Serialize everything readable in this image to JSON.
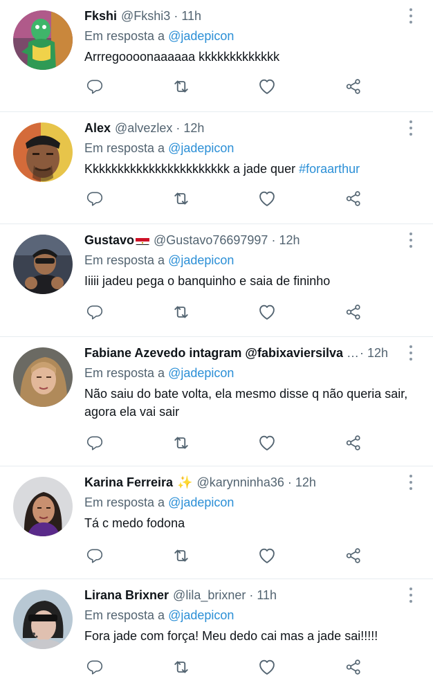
{
  "reply_prefix": "Em resposta a",
  "tweets": [
    {
      "name": "Fkshi",
      "handle": "@Fkshi3",
      "separator": "·",
      "time": "11h",
      "mention": "@jadepicon",
      "text": "Arrregoooonaaaaaa kkkkkkkkkkkkk",
      "avatar": "avatar-fkshi"
    },
    {
      "name": "Alex",
      "handle": "@alvezlex",
      "separator": "·",
      "time": "12h",
      "mention": "@jadepicon",
      "text_before": "Kkkkkkkkkkkkkkkkkkkkkkk a jade quer ",
      "hashtag": "#foraarthur",
      "avatar": "avatar-alex"
    },
    {
      "name": "Gustavo",
      "name_emoji": "flag-egypt",
      "handle": "@Gustavo76697997",
      "separator": "·",
      "time": "12h",
      "mention": "@jadepicon",
      "text": "Iiiii jadeu pega o banquinho e saia de fininho",
      "avatar": "avatar-gustavo"
    },
    {
      "name": "Fabiane Azevedo intagram @fabixaviersilva",
      "truncated_suffix": "…",
      "separator": "·",
      "time": "12h",
      "mention": "@jadepicon",
      "text": "Não saiu do bate volta, ela mesmo disse q não queria sair, agora ela vai sair",
      "avatar": "avatar-fabiane"
    },
    {
      "name": "Karina Ferreira",
      "name_emoji": "✨",
      "handle": "@karynninha36",
      "separator": "·",
      "time": "12h",
      "mention": "@jadepicon",
      "text": "Tá c medo fodona",
      "avatar": "avatar-karina"
    },
    {
      "name": "Lirana Brixner",
      "handle": "@lila_brixner",
      "separator": "·",
      "time": "11h",
      "mention": "@jadepicon",
      "text": "Fora jade com força! Meu dedo cai mas a jade sai!!!!!",
      "avatar": "avatar-lirana"
    }
  ],
  "icons": {
    "reply": "reply-icon",
    "retweet": "retweet-icon",
    "like": "like-icon",
    "share": "share-icon",
    "more": "more-options-icon"
  },
  "colors": {
    "text": "#0f1419",
    "secondary": "#536471",
    "link": "#2b8fd6",
    "icon": "#536471",
    "divider": "#e6ecf0"
  }
}
